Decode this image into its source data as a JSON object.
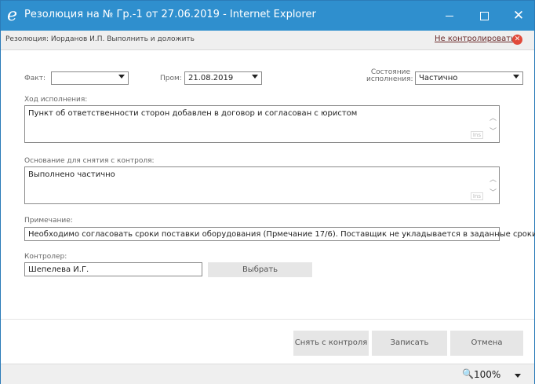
{
  "window": {
    "title": "Резолюция на № Гр.-1 от 27.06.2019 - Internet Explorer",
    "app_icon": "ie-icon",
    "icon_glyph": "e",
    "minimize_icon": "minimize-icon",
    "maximize_icon": "maximize-icon",
    "close_icon": "close-icon",
    "close_glyph": "✕",
    "accent_color": "#2f8fce"
  },
  "resolution_bar": {
    "text": "Резолюция: Иорданов И.П. Выполнить и доложить",
    "no_control_link": "Не контролировать",
    "no_control_icon_glyph": "✕"
  },
  "form": {
    "fact_label": "Факт:",
    "fact_value": "",
    "prom_label": "Пром:",
    "prom_value": "21.08.2019",
    "state_label_line1": "Состояние",
    "state_label_line2": "исполнения:",
    "state_value": "Частично",
    "progress_label": "Ход исполнения:",
    "progress_value": "Пункт об ответственности сторон добавлен в договор и согласован с юристом",
    "basis_label": "Основание для снятия с контроля:",
    "basis_value": "Выполнено частично",
    "ins_badge": "Ins",
    "note_label": "Примечание:",
    "note_value": "Необходимо согласовать сроки поставки оборудования (Прмечание 17/6). Поставщик не укладывается в заданные сроки.",
    "controller_label": "Контролер:",
    "controller_value": "Шепелева И.Г.",
    "select_button": "Выбрать"
  },
  "actions": {
    "remove_control": "Снять с контроля",
    "save": "Записать",
    "cancel": "Отмена"
  },
  "statusbar": {
    "zoom_icon": "zoom-icon",
    "zoom_glyph": "🔍",
    "zoom": "100%"
  }
}
